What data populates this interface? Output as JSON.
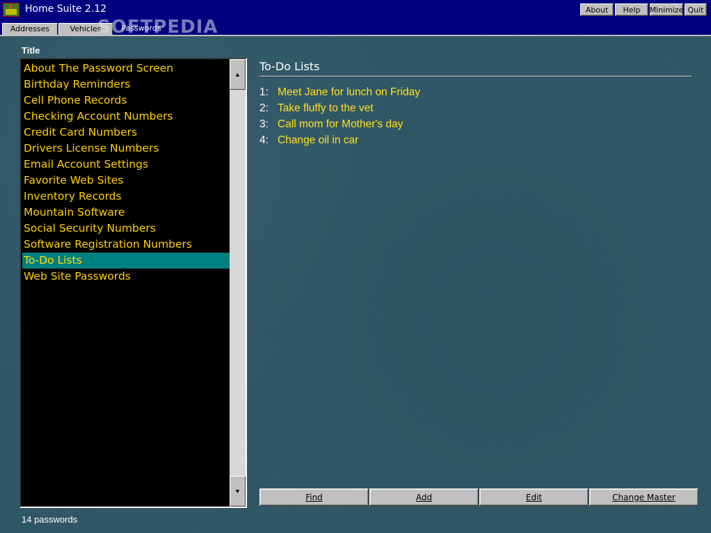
{
  "app": {
    "title": "Home Suite 2.12"
  },
  "window_buttons": {
    "about": "About",
    "help": "Help",
    "minimize": "Minimize",
    "quit": "Quit"
  },
  "tabs": [
    {
      "label": "Addresses"
    },
    {
      "label": "Vehicles"
    },
    {
      "label": "Passwords"
    }
  ],
  "watermark": "SOFTPEDIA",
  "list": {
    "header": "Title",
    "items": [
      "About The Password Screen",
      "Birthday Reminders",
      "Cell Phone Records",
      "Checking Account Numbers",
      "Credit Card Numbers",
      "Drivers License Numbers",
      "Email Account Settings",
      "Favorite Web Sites",
      "Inventory Records",
      "Mountain Software",
      "Social Security Numbers",
      "Software Registration Numbers",
      "To-Do Lists",
      "Web Site Passwords"
    ],
    "selected": "To-Do Lists",
    "status": "14 passwords"
  },
  "scrollbar": {
    "up_arrow": "▲",
    "down_arrow": "▼"
  },
  "detail": {
    "title": "To-Do Lists",
    "entries": [
      {
        "num": "1:",
        "text": "Meet Jane for lunch on Friday"
      },
      {
        "num": "2:",
        "text": "Take fluffy to the vet"
      },
      {
        "num": "3:",
        "text": "Call mom for Mother's day"
      },
      {
        "num": "4:",
        "text": "Change oil in car"
      }
    ]
  },
  "actions": {
    "find": "Find",
    "add": "Add",
    "edit": "Edit",
    "change_master": "Change Master"
  }
}
